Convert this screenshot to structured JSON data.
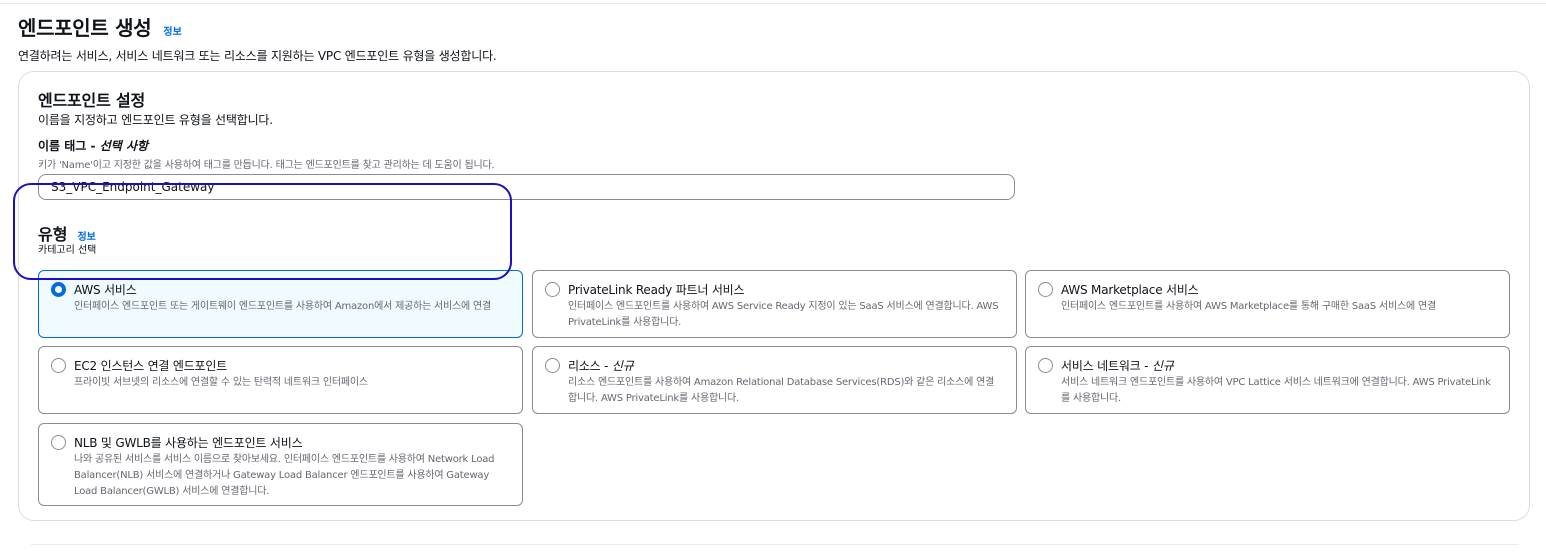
{
  "page": {
    "title": "엔드포인트 생성",
    "info_link": "정보",
    "description": "연결하려는 서비스, 서비스 네트워크 또는 리소스를 지원하는 VPC 엔드포인트 유형을 생성합니다."
  },
  "settings": {
    "title": "엔드포인트 설정",
    "description": "이름을 지정하고 엔드포인트 유형을 선택합니다.",
    "name_tag": {
      "label": "이름 태그 - ",
      "optional": "선택 사항",
      "description": "키가 'Name'이고 지정한 값을 사용하여 태그를 만듭니다. 태그는 엔드포인트를 찾고 관리하는 데 도움이 됩니다.",
      "value": "S3_VPC_Endpoint_Gateway"
    },
    "type": {
      "title": "유형",
      "info_link": "정보",
      "description": "카테고리 선택",
      "selected": "AWS 서비스",
      "options": [
        {
          "title": "AWS 서비스",
          "new_suffix": "",
          "description": "인터페이스 엔드포인트 또는 게이트웨이 엔드포인트를 사용하여 Amazon에서 제공하는 서비스에 연결"
        },
        {
          "title": "PrivateLink Ready 파트너 서비스",
          "new_suffix": "",
          "description": "인터페이스 엔드포인트를 사용하여 AWS Service Ready 지정이 있는 SaaS 서비스에 연결합니다. AWS PrivateLink를 사용합니다."
        },
        {
          "title": "AWS Marketplace 서비스",
          "new_suffix": "",
          "description": "인터페이스 엔드포인트를 사용하여 AWS Marketplace를 통해 구매한 SaaS 서비스에 연결"
        },
        {
          "title": "EC2 인스턴스 연결 엔드포인트",
          "new_suffix": "",
          "description": "프라이빗 서브넷의 리소스에 연결할 수 있는 탄력적 네트워크 인터페이스"
        },
        {
          "title": "리소스 - ",
          "new_suffix": "신규",
          "description": "리소스 엔드포인트를 사용하여 Amazon Relational Database Services(RDS)와 같은 리소스에 연결합니다. AWS PrivateLink를 사용합니다."
        },
        {
          "title": "서비스 네트워크 - ",
          "new_suffix": "신규",
          "description": "서비스 네트워크 엔드포인트를 사용하여 VPC Lattice 서비스 네트워크에 연결합니다. AWS PrivateLink를 사용합니다."
        },
        {
          "title": "NLB 및 GWLB를 사용하는 엔드포인트 서비스",
          "new_suffix": "",
          "description": "나와 공유된 서비스를 서비스 이름으로 찾아보세요. 인터페이스 엔드포인트를 사용하여 Network Load Balancer(NLB) 서비스에 연결하거나 Gateway Load Balancer 엔드포인트를 사용하여 Gateway Load Balancer(GWLB) 서비스에 연결합니다."
        }
      ]
    }
  },
  "colors": {
    "accent": "#006ce0",
    "selected_bg": "#f0fbff",
    "focus_ring": "#1b0fc1",
    "border": "#8c8c94",
    "secondary_text": "#656871"
  }
}
